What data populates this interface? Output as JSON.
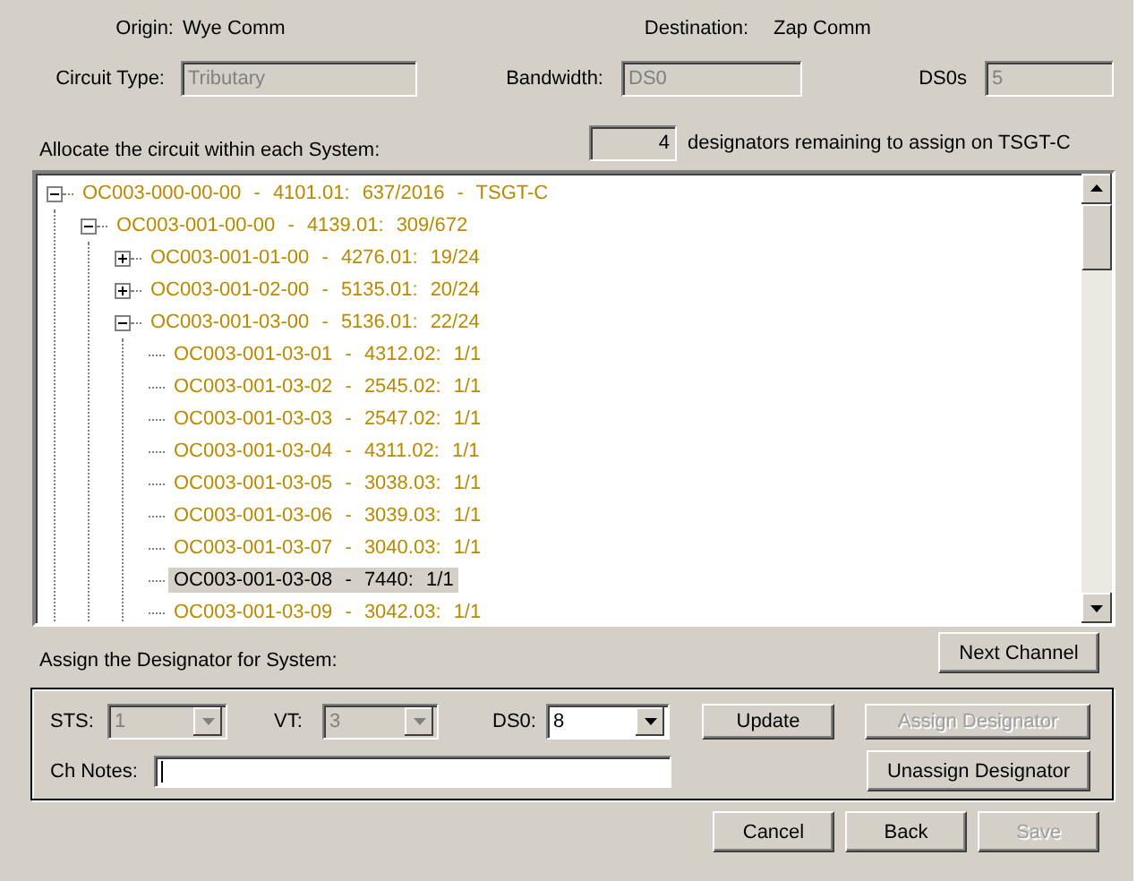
{
  "header": {
    "origin_label": "Origin:",
    "origin": "Wye Comm",
    "destination_label": "Destination:",
    "destination": "Zap Comm"
  },
  "fields": [
    {
      "label": "Circuit Type:",
      "value": "Tributary",
      "disabled": true
    },
    {
      "label": "Bandwidth:",
      "value": "DS0",
      "disabled": true
    },
    {
      "label": "DS0s",
      "value": "5",
      "disabled": true
    }
  ],
  "allocate_label": "Allocate the circuit within each System:",
  "remaining": {
    "count": "4",
    "text": "designators remaining to assign on TSGT-C"
  },
  "tree": [
    {
      "text": "OC003-000-00-00 - 4101.01: 637/2016 - TSGT-C",
      "expanded": true,
      "selected": false,
      "children": [
        {
          "text": "OC003-001-00-00 - 4139.01: 309/672",
          "expanded": true,
          "selected": false,
          "children": [
            {
              "text": "OC003-001-01-00 - 4276.01: 19/24",
              "expanded": false,
              "selected": false
            },
            {
              "text": "OC003-001-02-00 - 5135.01: 20/24",
              "expanded": false,
              "selected": false
            },
            {
              "text": "OC003-001-03-00 - 5136.01: 22/24",
              "expanded": true,
              "selected": false,
              "children": [
                {
                  "text": "OC003-001-03-01 - 4312.02: 1/1",
                  "selected": false
                },
                {
                  "text": "OC003-001-03-02 - 2545.02: 1/1",
                  "selected": false
                },
                {
                  "text": "OC003-001-03-03 - 2547.02: 1/1",
                  "selected": false
                },
                {
                  "text": "OC003-001-03-04 - 4311.02: 1/1",
                  "selected": false
                },
                {
                  "text": "OC003-001-03-05 - 3038.03: 1/1",
                  "selected": false
                },
                {
                  "text": "OC003-001-03-06 - 3039.03: 1/1",
                  "selected": false
                },
                {
                  "text": "OC003-001-03-07 - 3040.03: 1/1",
                  "selected": false
                },
                {
                  "text": "OC003-001-03-08 - 7440: 1/1",
                  "selected": true
                },
                {
                  "text": "OC003-001-03-09 - 3042.03: 1/1",
                  "selected": false
                }
              ]
            }
          ]
        }
      ]
    }
  ],
  "next_channel_button": {
    "label": "Next Channel",
    "disabled": false
  },
  "assign_label": "Assign the Designator for System:",
  "assign_group": {
    "combos": [
      {
        "label": "STS:",
        "value": "1",
        "disabled": true
      },
      {
        "label": "VT:",
        "value": "3",
        "disabled": true
      },
      {
        "label": "DS0:",
        "value": "8",
        "disabled": false
      }
    ],
    "notes_label": "Ch Notes:",
    "buttons": [
      {
        "label": "Update",
        "disabled": false
      },
      {
        "label": "Assign Designator",
        "disabled": true
      },
      {
        "label": "Unassign Designator",
        "disabled": false
      }
    ]
  },
  "footer_buttons": [
    {
      "label": "Cancel",
      "disabled": false
    },
    {
      "label": "Back",
      "disabled": false
    },
    {
      "label": "Save",
      "disabled": true
    }
  ]
}
